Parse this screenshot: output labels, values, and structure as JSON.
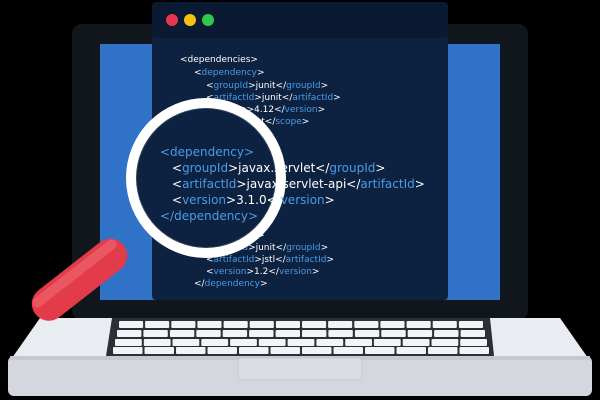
{
  "window": {
    "traffic_lights": [
      "#e8344e",
      "#f4c20d",
      "#2ec84a"
    ]
  },
  "code_small_top": [
    [
      "",
      "<",
      "dependencies",
      ">",
      "",
      "",
      "",
      ""
    ],
    [
      "",
      "<",
      "dependency",
      ">",
      "",
      "",
      "",
      ""
    ],
    [
      "<",
      "groupId",
      ">",
      "junit",
      "</",
      "groupId",
      ">"
    ],
    [
      "<",
      "artifactId",
      ">",
      "junit",
      "</",
      "artifactId",
      ">"
    ],
    [
      "",
      "4.12",
      "</",
      "version",
      ">"
    ],
    [
      "dependency",
      "",
      "</",
      "scope",
      ">"
    ]
  ],
  "code_big": {
    "l1": "<dependency>",
    "l2a": "<",
    "l2b": "groupId",
    "l2c": ">javax.servlet</",
    "l2d": "groupId",
    "l2e": ">",
    "l3a": "<",
    "l3b": "artifactId",
    "l3c": ">javax.servlet-api</",
    "l3d": "artifactId",
    "l3e": ">",
    "l4a": "<",
    "l4b": "version",
    "l4c": ">3.1.0</",
    "l4d": "version",
    "l4e": ">",
    "l5": "</dependency>"
  },
  "code_small_bottom": {
    "b1a": "<dependency>",
    "b1b": "groupId>",
    "b2a": "l</",
    "b2b": "artifactId",
    "b2c": ">",
    "b3a": "1.2</",
    "b3b": "version",
    "b3c": ">",
    "b4a": "</",
    "b4b": "dependency",
    "b4c": ">"
  },
  "colors": {
    "screen_bg": "#0c2240",
    "tag_blue": "#4a9be8",
    "text_white": "#ffffff",
    "magnifier_handle": "#e23b4a",
    "laptop_body": "#e9ecf0",
    "keyboard_bg": "#dfe3e8",
    "key": "#2b2f36",
    "side_panel": "#2f72c8"
  }
}
